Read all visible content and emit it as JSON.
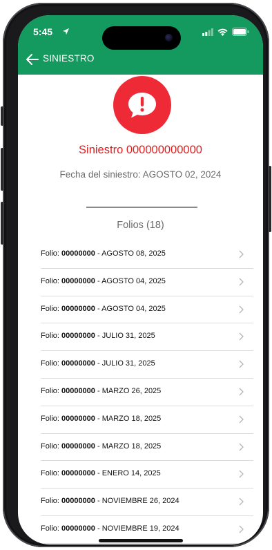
{
  "status": {
    "time": "5:45",
    "icons": [
      "location-arrow-icon",
      "signal-icon",
      "wifi-icon",
      "battery-icon"
    ]
  },
  "navbar": {
    "title": "SINIESTRO",
    "back_icon": "arrow-left-icon"
  },
  "claim": {
    "alert_icon": "alert-chat-bubble-icon",
    "title": "Siniestro 000000000000",
    "date_text": "Fecha del siniestro: AGOSTO 02, 2024",
    "folios_label": "Folios (18)"
  },
  "folios": [
    {
      "prefix": "Folio:",
      "number": "00000000",
      "date": "- AGOSTO 08, 2025"
    },
    {
      "prefix": "Folio:",
      "number": "00000000",
      "date": "- AGOSTO 04, 2025"
    },
    {
      "prefix": "Folio:",
      "number": "00000000",
      "date": "- AGOSTO 04, 2025"
    },
    {
      "prefix": "Folio:",
      "number": "00000000",
      "date": "- JULIO 31, 2025"
    },
    {
      "prefix": "Folio:",
      "number": "00000000",
      "date": "- JULIO 31, 2025"
    },
    {
      "prefix": "Folio:",
      "number": "00000000",
      "date": "- MARZO 26, 2025"
    },
    {
      "prefix": "Folio:",
      "number": "00000000",
      "date": "- MARZO 18, 2025"
    },
    {
      "prefix": "Folio:",
      "number": "00000000",
      "date": "- MARZO 18, 2025"
    },
    {
      "prefix": "Folio:",
      "number": "00000000",
      "date": "- ENERO 14, 2025"
    },
    {
      "prefix": "Folio:",
      "number": "00000000",
      "date": "- NOVIEMBRE 26, 2024"
    },
    {
      "prefix": "Folio:",
      "number": "00000000",
      "date": "- NOVIEMBRE 19, 2024"
    }
  ],
  "colors": {
    "header_green": "#14995e",
    "alert_red": "#ee2a36",
    "title_red": "#e02020"
  }
}
